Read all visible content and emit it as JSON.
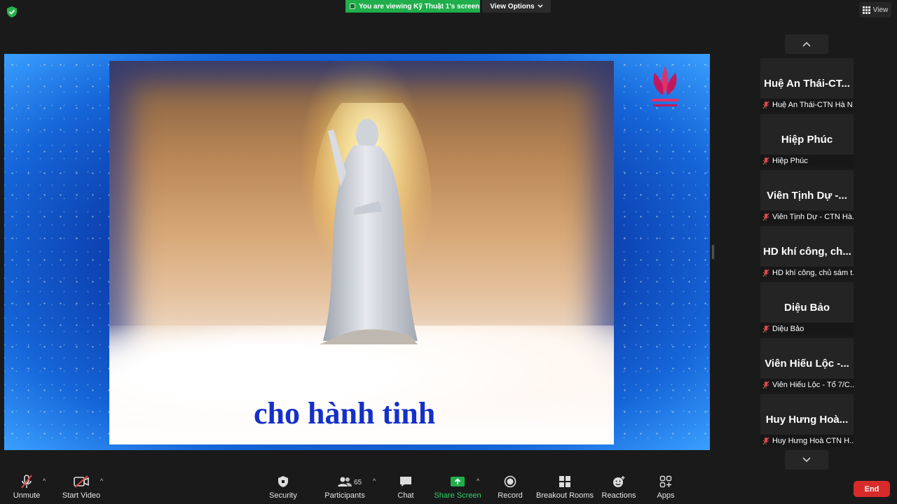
{
  "banner": {
    "viewing_text": "You are viewing Kỹ Thuật 1's screen",
    "view_options": "View Options",
    "view_label": "View"
  },
  "shared_screen": {
    "caption": "cho hành tinh"
  },
  "participants": [
    {
      "display": "Huệ An Thái-CT...",
      "name": "Huệ An Thái-CTN Hà N..."
    },
    {
      "display": "Hiệp Phúc",
      "name": "Hiệp Phúc"
    },
    {
      "display": "Viên Tịnh Dự -...",
      "name": "Viên Tịnh Dự - CTN Hà..."
    },
    {
      "display": "HD khí công, ch...",
      "name": "HD khí công, chủ sám t..."
    },
    {
      "display": "Diệu Bảo",
      "name": "Diệu Bảo"
    },
    {
      "display": "Viên Hiếu Lộc -...",
      "name": "Viên Hiếu Lộc - Tổ 7/C..."
    },
    {
      "display": "Huy Hưng Hoà...",
      "name": "Huy Hưng Hoà CTN H..."
    }
  ],
  "toolbar": {
    "unmute": "Unmute",
    "start_video": "Start Video",
    "security": "Security",
    "participants": "Participants",
    "participants_count": "65",
    "chat": "Chat",
    "share_screen": "Share Screen",
    "record": "Record",
    "breakout_rooms": "Breakout Rooms",
    "reactions": "Reactions",
    "apps": "Apps",
    "end": "End"
  },
  "colors": {
    "banner_green": "#1fae4b",
    "share_green": "#2fd16a",
    "end_red": "#d72b2b",
    "muted_red": "#e04848"
  }
}
